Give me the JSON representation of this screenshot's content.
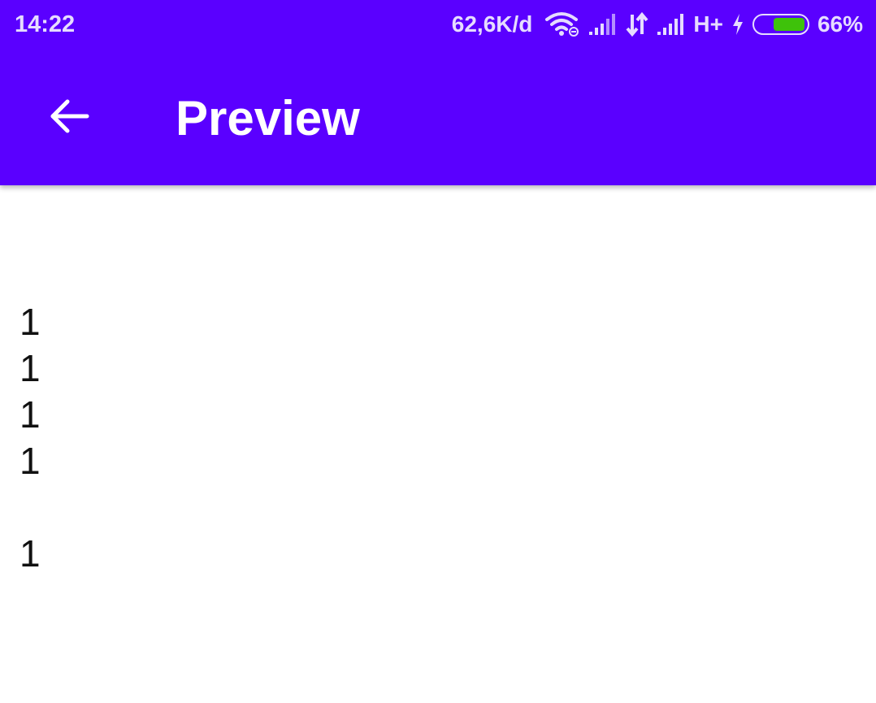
{
  "status_bar": {
    "time": "14:22",
    "speed": "62,6K/d",
    "network_type": "H+",
    "battery_percent": "66%",
    "battery_level": 0.66,
    "icons": [
      "wifi-icon",
      "signal-icon",
      "data-transfer-icon",
      "signal-icon",
      "charging-icon",
      "battery-icon"
    ],
    "colors": {
      "text": "#e6dcff",
      "battery_fill": "#3ec20a"
    }
  },
  "app_bar": {
    "title": "Preview",
    "back_icon": "arrow-back-icon",
    "color": "#5a00ff"
  },
  "content": {
    "lines": [
      "1",
      "1",
      "1",
      "1",
      "",
      "1"
    ]
  }
}
